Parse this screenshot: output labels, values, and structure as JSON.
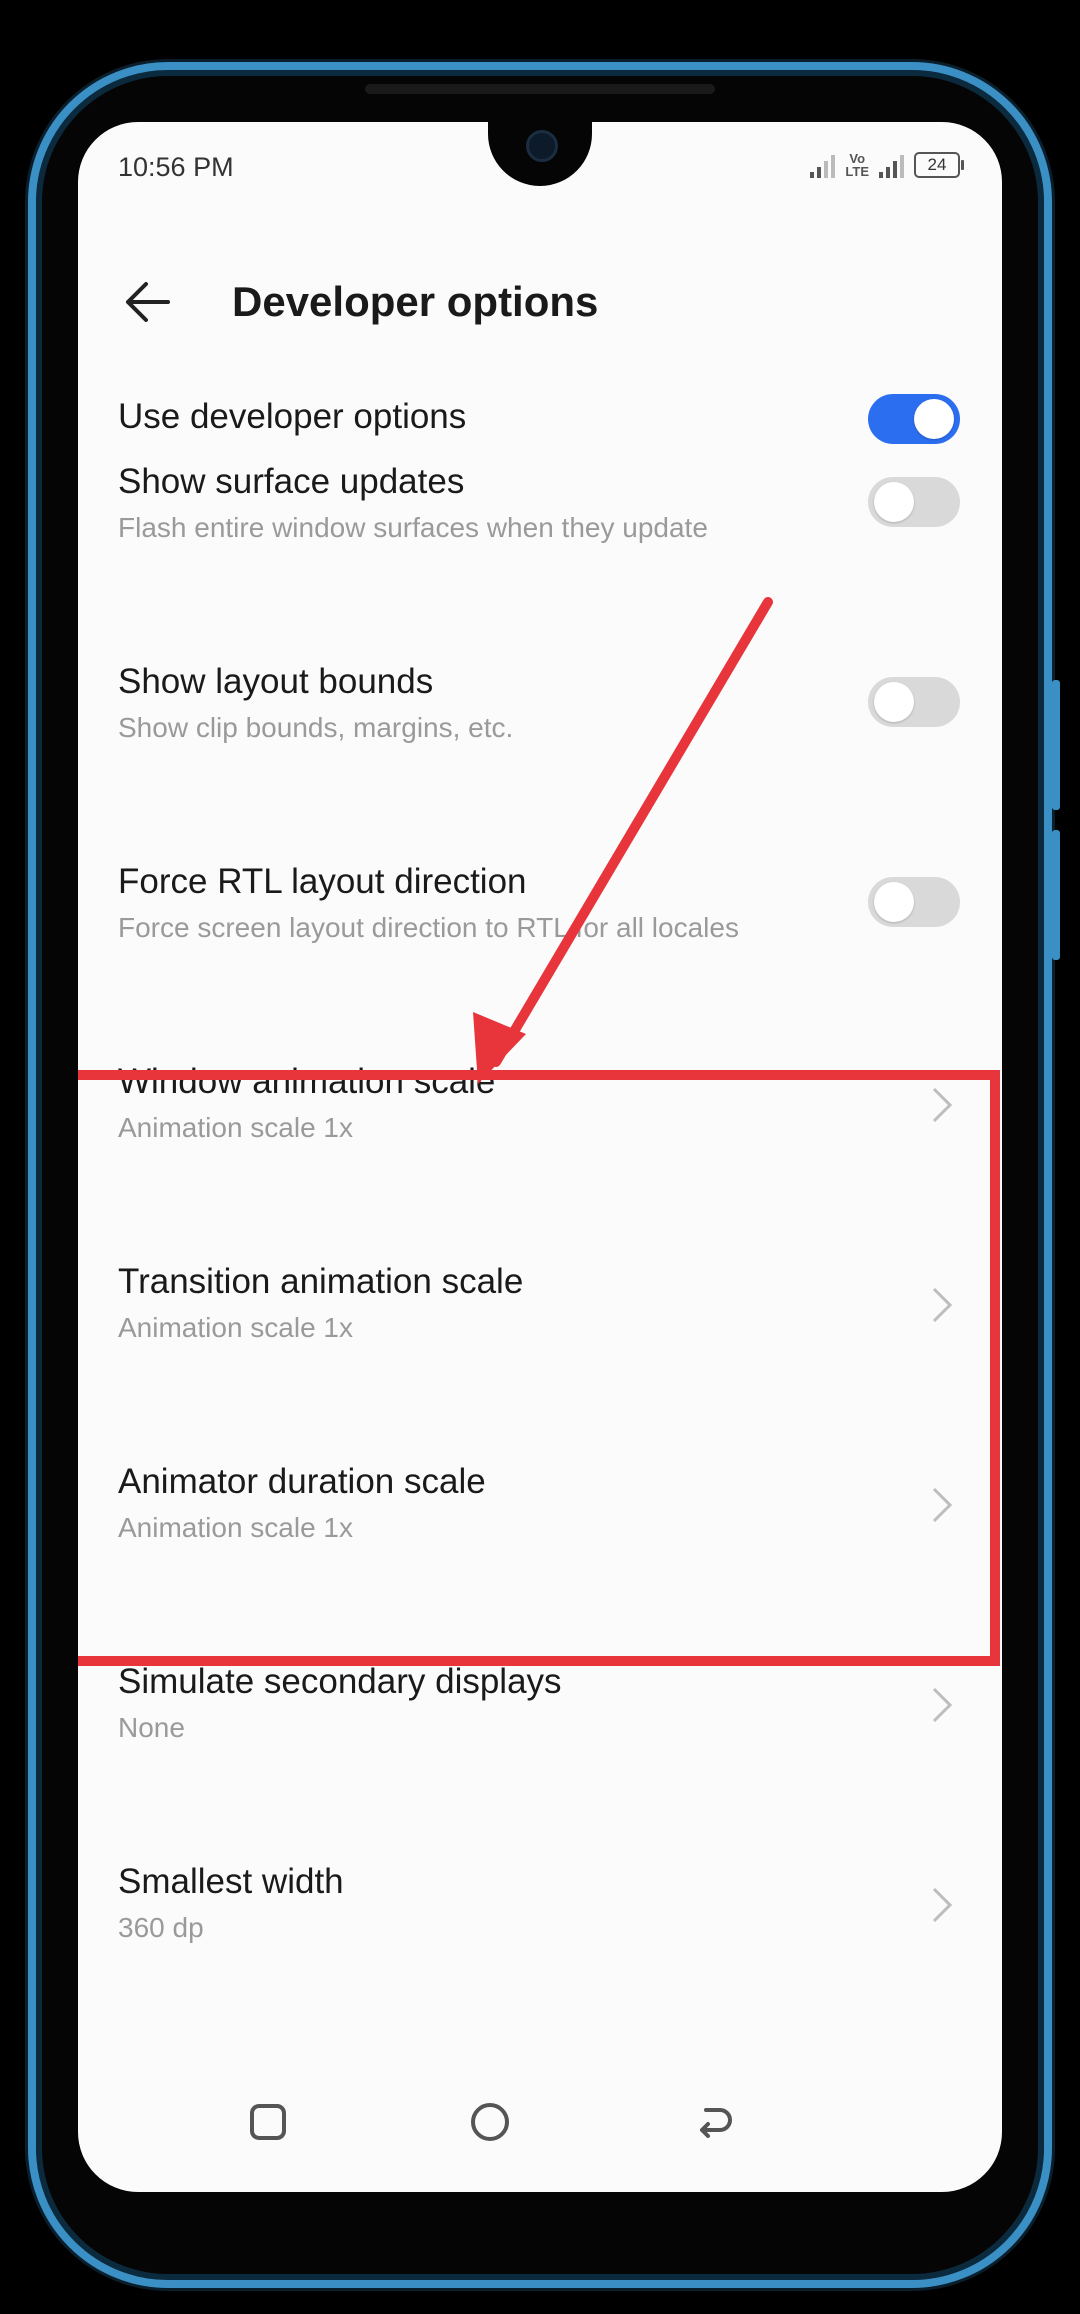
{
  "status_bar": {
    "time": "10:56 PM",
    "network_label_top": "Vo",
    "network_label_bottom": "LTE",
    "battery_level": "24"
  },
  "header": {
    "title": "Developer options"
  },
  "settings": [
    {
      "title": "Use developer options",
      "subtitle": "",
      "control": "toggle",
      "enabled": true
    },
    {
      "title": "Show surface updates",
      "subtitle": "Flash entire window surfaces when they update",
      "control": "toggle",
      "enabled": false
    },
    {
      "title": "Show layout bounds",
      "subtitle": "Show clip bounds, margins, etc.",
      "control": "toggle",
      "enabled": false
    },
    {
      "title": "Force RTL layout direction",
      "subtitle": "Force screen layout direction to RTL for all locales",
      "control": "toggle",
      "enabled": false
    },
    {
      "title": "Window animation scale",
      "subtitle": "Animation scale 1x",
      "control": "chevron"
    },
    {
      "title": "Transition animation scale",
      "subtitle": "Animation scale 1x",
      "control": "chevron"
    },
    {
      "title": "Animator duration scale",
      "subtitle": "Animation scale 1x",
      "control": "chevron"
    },
    {
      "title": "Simulate secondary displays",
      "subtitle": "None",
      "control": "chevron"
    },
    {
      "title": "Smallest width",
      "subtitle": "360 dp",
      "control": "chevron"
    }
  ],
  "colors": {
    "accent": "#2b6ef0",
    "annotation": "#e8353b",
    "frame": "#3a8fc4"
  },
  "nav_icons": [
    "recents-icon",
    "home-icon",
    "back-icon"
  ]
}
